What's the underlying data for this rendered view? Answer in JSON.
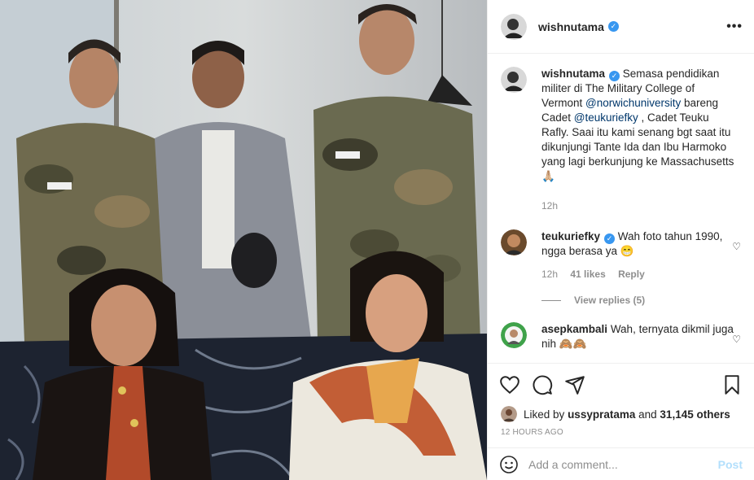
{
  "post": {
    "username": "wishnutama",
    "more_icon": "ellipsis-icon",
    "verified_icon": "verified-badge-icon",
    "brand_color": "#3897f0"
  },
  "caption": {
    "username": "wishnutama",
    "text_1": "Semasa pendidikan militer di The Military College of Vermont ",
    "mention_1": "@norwichuniversity",
    "text_2": " bareng Cadet ",
    "mention_2": "@teukuriefky",
    "text_3": " , Cadet Teuku Rafly. Saai itu kami senang bgt saat itu dikunjungi Tante Ida dan Ibu Harmoko yang lagi berkunjung ke Massachusetts🙏🏼",
    "time": "12h"
  },
  "comments": [
    {
      "username": "teukuriefky",
      "text": "Wah foto tahun 1990, ngga berasa ya 😁",
      "time": "12h",
      "likes": "41 likes",
      "reply": "Reply",
      "view_replies": "View replies (5)"
    },
    {
      "username": "asepkambali",
      "text": "Wah, ternyata dikmil juga nih 🙈🙈"
    }
  ],
  "likes": {
    "prefix": "Liked by ",
    "user": "ussypratama",
    "middle": " and ",
    "others": "31,145 others"
  },
  "timestamp": "12 HOURS AGO",
  "add_comment": {
    "placeholder": "Add a comment...",
    "post_label": "Post",
    "post_color": "#b2dffc"
  },
  "icons": [
    "heart-icon",
    "comment-icon",
    "share-icon",
    "bookmark-icon",
    "emoji-icon"
  ]
}
